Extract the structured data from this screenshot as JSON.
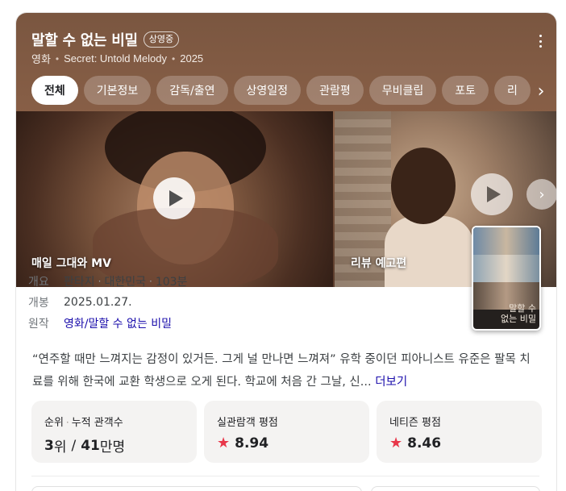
{
  "header": {
    "title": "말할 수 없는 비밀",
    "status_badge": "상영중",
    "category": "영화",
    "english_title": "Secret: Untold Melody",
    "year": "2025"
  },
  "tabs": [
    {
      "label": "전체",
      "active": true
    },
    {
      "label": "기본정보"
    },
    {
      "label": "감독/출연"
    },
    {
      "label": "상영일정"
    },
    {
      "label": "관람평"
    },
    {
      "label": "무비클립"
    },
    {
      "label": "포토"
    },
    {
      "label": "리"
    }
  ],
  "videos": [
    {
      "label": "매일 그대와 MV"
    },
    {
      "label": "리뷰 예고편"
    }
  ],
  "poster": {
    "title_line1": "말할 수",
    "title_line2": "없는 비밀"
  },
  "info": {
    "overview_key": "개요",
    "genre": "판타지",
    "country": "대한민국",
    "runtime": "103분",
    "release_key": "개봉",
    "release_date": "2025.01.27.",
    "original_key": "원작",
    "original_work": "영화/말할 수 없는 비밀"
  },
  "synopsis": {
    "text": "“연주할 때만 느껴지는 감정이 있거든. 그게 널 만나면 느껴져” 유학 중이던 피아니스트 유준은 팔목 치료를 위해 한국에 교환 학생으로 오게 된다. 학교에 처음 간 그날, 신... ",
    "more_label": "더보기"
  },
  "stats": {
    "rank_label": "순위",
    "audience_label": "누적 관객수",
    "rank_value": "3",
    "rank_unit": "위",
    "separator": "/",
    "audience_value": "41",
    "audience_unit": "만명",
    "real_rating_label": "실관람객 평점",
    "real_rating_value": "8.94",
    "netizen_rating_label": "네티즌 평점",
    "netizen_rating_value": "8.46"
  },
  "colors": {
    "hero_bg": "#7a5640",
    "link": "#1a0dab",
    "star": "#e8374a",
    "stat_bg": "#f4f3f2"
  },
  "icons": {
    "more": "more-vert-icon",
    "tabs_next": "chevron-right-icon",
    "play": "play-icon",
    "star": "star-icon"
  }
}
